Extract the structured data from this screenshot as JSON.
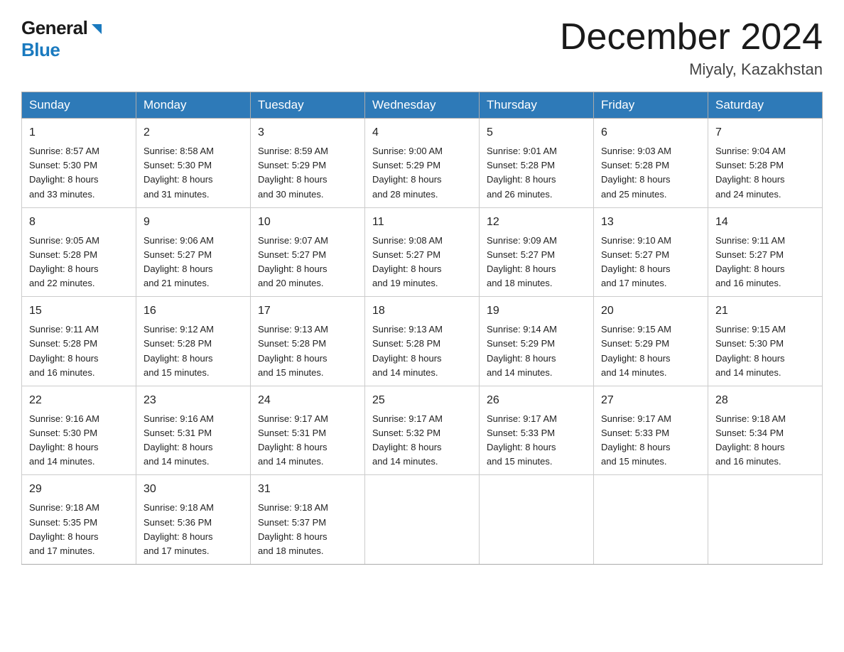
{
  "logo": {
    "general": "General",
    "blue": "Blue",
    "triangle": "▶"
  },
  "title": "December 2024",
  "location": "Miyaly, Kazakhstan",
  "days_of_week": [
    "Sunday",
    "Monday",
    "Tuesday",
    "Wednesday",
    "Thursday",
    "Friday",
    "Saturday"
  ],
  "weeks": [
    [
      {
        "day": "1",
        "sunrise": "8:57 AM",
        "sunset": "5:30 PM",
        "daylight": "8 hours and 33 minutes."
      },
      {
        "day": "2",
        "sunrise": "8:58 AM",
        "sunset": "5:30 PM",
        "daylight": "8 hours and 31 minutes."
      },
      {
        "day": "3",
        "sunrise": "8:59 AM",
        "sunset": "5:29 PM",
        "daylight": "8 hours and 30 minutes."
      },
      {
        "day": "4",
        "sunrise": "9:00 AM",
        "sunset": "5:29 PM",
        "daylight": "8 hours and 28 minutes."
      },
      {
        "day": "5",
        "sunrise": "9:01 AM",
        "sunset": "5:28 PM",
        "daylight": "8 hours and 26 minutes."
      },
      {
        "day": "6",
        "sunrise": "9:03 AM",
        "sunset": "5:28 PM",
        "daylight": "8 hours and 25 minutes."
      },
      {
        "day": "7",
        "sunrise": "9:04 AM",
        "sunset": "5:28 PM",
        "daylight": "8 hours and 24 minutes."
      }
    ],
    [
      {
        "day": "8",
        "sunrise": "9:05 AM",
        "sunset": "5:28 PM",
        "daylight": "8 hours and 22 minutes."
      },
      {
        "day": "9",
        "sunrise": "9:06 AM",
        "sunset": "5:27 PM",
        "daylight": "8 hours and 21 minutes."
      },
      {
        "day": "10",
        "sunrise": "9:07 AM",
        "sunset": "5:27 PM",
        "daylight": "8 hours and 20 minutes."
      },
      {
        "day": "11",
        "sunrise": "9:08 AM",
        "sunset": "5:27 PM",
        "daylight": "8 hours and 19 minutes."
      },
      {
        "day": "12",
        "sunrise": "9:09 AM",
        "sunset": "5:27 PM",
        "daylight": "8 hours and 18 minutes."
      },
      {
        "day": "13",
        "sunrise": "9:10 AM",
        "sunset": "5:27 PM",
        "daylight": "8 hours and 17 minutes."
      },
      {
        "day": "14",
        "sunrise": "9:11 AM",
        "sunset": "5:27 PM",
        "daylight": "8 hours and 16 minutes."
      }
    ],
    [
      {
        "day": "15",
        "sunrise": "9:11 AM",
        "sunset": "5:28 PM",
        "daylight": "8 hours and 16 minutes."
      },
      {
        "day": "16",
        "sunrise": "9:12 AM",
        "sunset": "5:28 PM",
        "daylight": "8 hours and 15 minutes."
      },
      {
        "day": "17",
        "sunrise": "9:13 AM",
        "sunset": "5:28 PM",
        "daylight": "8 hours and 15 minutes."
      },
      {
        "day": "18",
        "sunrise": "9:13 AM",
        "sunset": "5:28 PM",
        "daylight": "8 hours and 14 minutes."
      },
      {
        "day": "19",
        "sunrise": "9:14 AM",
        "sunset": "5:29 PM",
        "daylight": "8 hours and 14 minutes."
      },
      {
        "day": "20",
        "sunrise": "9:15 AM",
        "sunset": "5:29 PM",
        "daylight": "8 hours and 14 minutes."
      },
      {
        "day": "21",
        "sunrise": "9:15 AM",
        "sunset": "5:30 PM",
        "daylight": "8 hours and 14 minutes."
      }
    ],
    [
      {
        "day": "22",
        "sunrise": "9:16 AM",
        "sunset": "5:30 PM",
        "daylight": "8 hours and 14 minutes."
      },
      {
        "day": "23",
        "sunrise": "9:16 AM",
        "sunset": "5:31 PM",
        "daylight": "8 hours and 14 minutes."
      },
      {
        "day": "24",
        "sunrise": "9:17 AM",
        "sunset": "5:31 PM",
        "daylight": "8 hours and 14 minutes."
      },
      {
        "day": "25",
        "sunrise": "9:17 AM",
        "sunset": "5:32 PM",
        "daylight": "8 hours and 14 minutes."
      },
      {
        "day": "26",
        "sunrise": "9:17 AM",
        "sunset": "5:33 PM",
        "daylight": "8 hours and 15 minutes."
      },
      {
        "day": "27",
        "sunrise": "9:17 AM",
        "sunset": "5:33 PM",
        "daylight": "8 hours and 15 minutes."
      },
      {
        "day": "28",
        "sunrise": "9:18 AM",
        "sunset": "5:34 PM",
        "daylight": "8 hours and 16 minutes."
      }
    ],
    [
      {
        "day": "29",
        "sunrise": "9:18 AM",
        "sunset": "5:35 PM",
        "daylight": "8 hours and 17 minutes."
      },
      {
        "day": "30",
        "sunrise": "9:18 AM",
        "sunset": "5:36 PM",
        "daylight": "8 hours and 17 minutes."
      },
      {
        "day": "31",
        "sunrise": "9:18 AM",
        "sunset": "5:37 PM",
        "daylight": "8 hours and 18 minutes."
      },
      null,
      null,
      null,
      null
    ]
  ],
  "labels": {
    "sunrise": "Sunrise:",
    "sunset": "Sunset:",
    "daylight": "Daylight:"
  }
}
